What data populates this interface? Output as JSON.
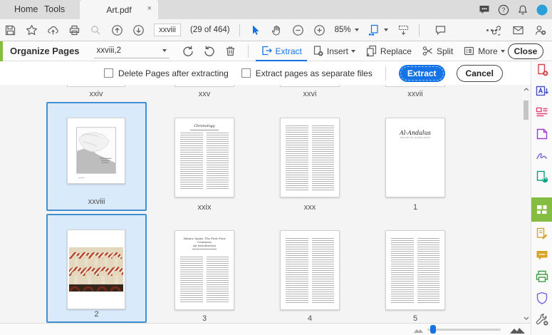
{
  "window": {
    "tabs": [
      {
        "label": "Home"
      },
      {
        "label": "Tools"
      }
    ],
    "document_tab": "Art.pdf",
    "close_tab_glyph": "×"
  },
  "toolbar": {
    "page_current": "xxviii",
    "page_info": "(29 of 464)",
    "zoom_level": "85%",
    "icons": [
      "save",
      "star",
      "share-cloud",
      "print",
      "search",
      "previous-page",
      "next-page",
      "select-tool",
      "hand-tool",
      "zoom-out",
      "zoom-in",
      "fit-page",
      "page-display",
      "comment",
      "more-options",
      "link",
      "email",
      "add-user"
    ]
  },
  "tabbar_icons": [
    "chat",
    "help",
    "notifications",
    "account-avatar"
  ],
  "icons": {
    "help_glyph": "?"
  },
  "organize": {
    "title": "Organize Pages",
    "page_range": "xxviii,2",
    "extract_label": "Extract",
    "insert_label": "Insert",
    "replace_label": "Replace",
    "split_label": "Split",
    "more_label": "More",
    "close_label": "Close",
    "icon_tools": [
      "rotate-counterclockwise",
      "rotate-clockwise",
      "delete-pages"
    ]
  },
  "extract_bar": {
    "delete_after_label": "Delete Pages after extracting",
    "delete_after_checked": false,
    "separate_files_label": "Extract pages as separate files",
    "separate_files_checked": false,
    "extract_button": "Extract",
    "cancel_button": "Cancel"
  },
  "thumbnails": {
    "partial_labels": [
      "xxiv",
      "xxv",
      "xxvi",
      "xxvii"
    ],
    "row1": [
      {
        "label": "xxviii",
        "selected": true,
        "kind": "map-plate"
      },
      {
        "label": "xxix",
        "selected": false,
        "kind": "text",
        "heading": "Chronology"
      },
      {
        "label": "xxx",
        "selected": false,
        "kind": "text"
      },
      {
        "label": "1",
        "selected": false,
        "kind": "title-page",
        "title": "Al-Andalus",
        "subtitle": "THE ART OF ISLAMIC SPAIN"
      }
    ],
    "row2": [
      {
        "label": "2",
        "selected": true,
        "kind": "photo-plate"
      },
      {
        "label": "3",
        "selected": false,
        "kind": "chapter",
        "heading_lines": [
          "Islamic Spain: The First Four",
          "Centuries",
          "An Introduction"
        ]
      },
      {
        "label": "4",
        "selected": false,
        "kind": "text"
      },
      {
        "label": "5",
        "selected": false,
        "kind": "text"
      }
    ]
  },
  "sidebar_tools": [
    "create-pdf",
    "export-pdf",
    "edit-pdf",
    "combine-files",
    "fill-and-sign",
    "send-for-comments",
    "organize-pages",
    "request-signatures",
    "comment",
    "scan-and-ocr",
    "protect",
    "more-tools"
  ],
  "sidebar_active_tool": "organize-pages",
  "colors": {
    "accent_blue": "#1473e6",
    "selection_fill": "#d9eafb",
    "selection_border": "#3f8fd2",
    "organize_green": "#85bd3c",
    "active_tool_green": "#84bd41"
  }
}
